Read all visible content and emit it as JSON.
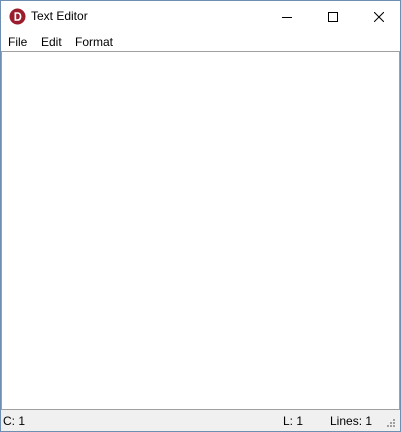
{
  "window": {
    "title": "Text Editor",
    "app_icon": "d-logo-icon",
    "controls": {
      "minimize_icon": "minimize-icon",
      "maximize_icon": "maximize-icon",
      "close_icon": "close-icon"
    }
  },
  "menu": {
    "items": [
      {
        "label": "File"
      },
      {
        "label": "Edit"
      },
      {
        "label": "Format"
      }
    ]
  },
  "editor": {
    "value": ""
  },
  "status": {
    "column": "C: 1",
    "line": "L: 1",
    "lines": "Lines: 1",
    "grip_icon": "resize-grip-icon"
  },
  "colors": {
    "app_icon_red": "#9b1c2c",
    "statusbar_bg": "#f0f0f0",
    "window_border": "#6f8fb0"
  }
}
